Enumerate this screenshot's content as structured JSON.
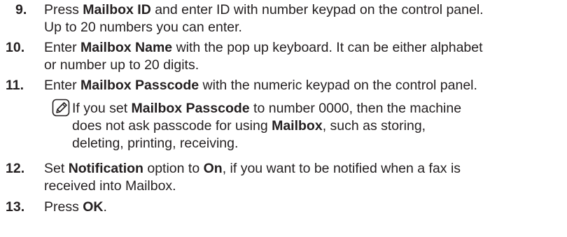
{
  "steps": [
    {
      "number": "9.",
      "lines": [
        [
          {
            "t": "Press ",
            "b": false
          },
          {
            "t": "Mailbox ID",
            "b": true
          },
          {
            "t": " and enter ID with number keypad on the control panel.",
            "b": false
          }
        ],
        [
          {
            "t": "Up to 20 numbers you can enter.",
            "b": false
          }
        ]
      ]
    },
    {
      "number": "10.",
      "lines": [
        [
          {
            "t": "Enter ",
            "b": false
          },
          {
            "t": "Mailbox Name",
            "b": true
          },
          {
            "t": " with the pop up keyboard. It can be either alphabet",
            "b": false
          }
        ],
        [
          {
            "t": "or number up to 20 digits.",
            "b": false
          }
        ]
      ]
    },
    {
      "number": "11.",
      "lines": [
        [
          {
            "t": "Enter ",
            "b": false
          },
          {
            "t": "Mailbox Passcode",
            "b": true
          },
          {
            "t": " with the numeric keypad on the control panel.",
            "b": false
          }
        ]
      ]
    },
    {
      "number": "12.",
      "lines": [
        [
          {
            "t": "Set ",
            "b": false
          },
          {
            "t": "Notification",
            "b": true
          },
          {
            "t": " option to ",
            "b": false
          },
          {
            "t": "On",
            "b": true
          },
          {
            "t": ", if you want to be notified when a fax is",
            "b": false
          }
        ],
        [
          {
            "t": "received into Mailbox.",
            "b": false
          }
        ]
      ]
    },
    {
      "number": "13.",
      "lines": [
        [
          {
            "t": "Press ",
            "b": false
          },
          {
            "t": "OK",
            "b": true
          },
          {
            "t": ".",
            "b": false
          }
        ]
      ]
    }
  ],
  "note": {
    "icon": "note-pencil-icon",
    "lines": [
      [
        {
          "t": "If you set ",
          "b": false
        },
        {
          "t": "Mailbox Passcode",
          "b": true
        },
        {
          "t": " to number 0000, then the machine",
          "b": false
        }
      ],
      [
        {
          "t": "does not ask passcode for using ",
          "b": false
        },
        {
          "t": "Mailbox",
          "b": true
        },
        {
          "t": ", such as storing,",
          "b": false
        }
      ],
      [
        {
          "t": "deleting, printing, receiving.",
          "b": false
        }
      ]
    ]
  },
  "colors": {
    "text": "#231f20"
  }
}
